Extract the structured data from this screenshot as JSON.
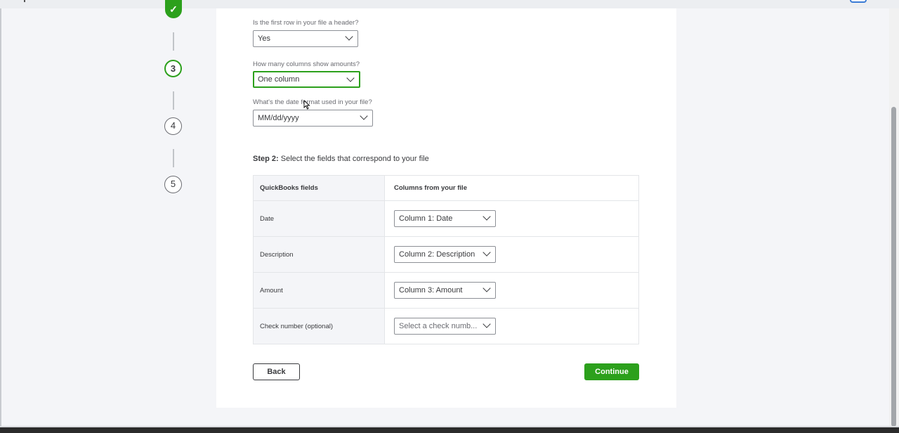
{
  "stepper": {
    "done_icon": "check-icon",
    "steps": [
      {
        "label": "3",
        "state": "active"
      },
      {
        "label": "4",
        "state": "pending"
      },
      {
        "label": "5",
        "state": "pending"
      }
    ]
  },
  "form": {
    "header_question": "Is the first row in your file a header?",
    "header_value": "Yes",
    "amount_columns_question": "How many columns show amounts?",
    "amount_columns_value": "One column",
    "date_format_question": "What's the date format used in your file?",
    "date_format_value": "MM/dd/yyyy"
  },
  "step2": {
    "prefix": "Step 2:",
    "text": " Select the fields that correspond to your file"
  },
  "mapping": {
    "col_qb": "QuickBooks fields",
    "col_file": "Columns from your file",
    "rows": [
      {
        "field": "Date",
        "value": "Column 1: Date"
      },
      {
        "field": "Description",
        "value": "Column 2: Description"
      },
      {
        "field": "Amount",
        "value": "Column 3: Amount"
      },
      {
        "field": "Check number (optional)",
        "value": "Select a check numb..."
      }
    ]
  },
  "buttons": {
    "back": "Back",
    "continue": "Continue"
  },
  "colors": {
    "accent_green": "#2ca01c",
    "text": "#393a3d",
    "muted": "#6b6c72"
  }
}
